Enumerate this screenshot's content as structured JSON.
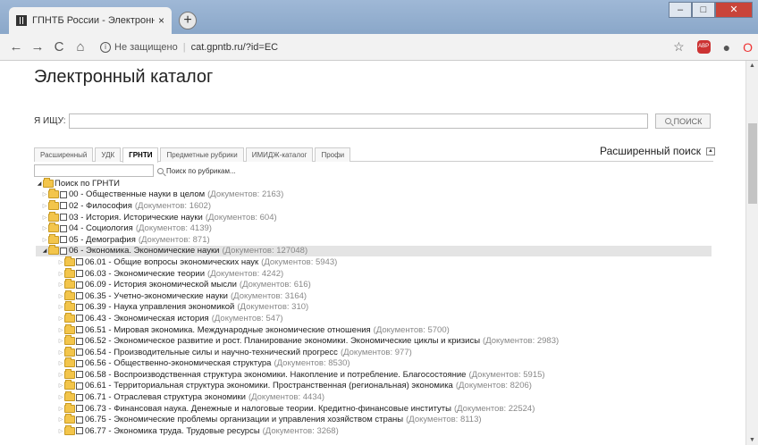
{
  "browser": {
    "tab_title": "ГПНТБ России - Электронный к",
    "tab_close": "×",
    "new_tab": "+",
    "security_label": "Не защищено",
    "url": "cat.gpntb.ru/?id=EC"
  },
  "page": {
    "title": "Электронный каталог",
    "search_label": "Я ИЩУ:",
    "search_value": "",
    "search_button": "ПОИСК",
    "advanced_search": "Расширенный поиск",
    "tabs": [
      "Расширенный",
      "УДК",
      "ГРНТИ",
      "Предметные рубрики",
      "ИМИДЖ-каталог",
      "Профи"
    ],
    "active_tab": "ГРНТИ",
    "rubric_button": "Поиск по рубрикам..."
  },
  "tree": {
    "root": "Поиск по ГРНТИ",
    "items": [
      {
        "label": "00 - Общественные науки в целом",
        "count": "(Документов: 2163)",
        "level": 1,
        "open": false
      },
      {
        "label": "02 - Философия",
        "count": "(Документов: 1602)",
        "level": 1,
        "open": false
      },
      {
        "label": "03 - История. Исторические науки",
        "count": "(Документов: 604)",
        "level": 1,
        "open": false
      },
      {
        "label": "04 - Социология",
        "count": "(Документов: 4139)",
        "level": 1,
        "open": false
      },
      {
        "label": "05 - Демография",
        "count": "(Документов: 871)",
        "level": 1,
        "open": false
      },
      {
        "label": "06 - Экономика. Экономические науки",
        "count": "(Документов: 127048)",
        "level": 1,
        "open": true,
        "selected": true
      },
      {
        "label": "06.01 - Общие вопросы экономических наук",
        "count": "(Документов: 5943)",
        "level": 2
      },
      {
        "label": "06.03 - Экономические теории",
        "count": "(Документов: 4242)",
        "level": 2
      },
      {
        "label": "06.09 - История экономической мысли",
        "count": "(Документов: 616)",
        "level": 2
      },
      {
        "label": "06.35 - Учетно-экономические науки",
        "count": "(Документов: 3164)",
        "level": 2
      },
      {
        "label": "06.39 - Наука управления экономикой",
        "count": "(Документов: 310)",
        "level": 2
      },
      {
        "label": "06.43 - Экономическая история",
        "count": "(Документов: 547)",
        "level": 2
      },
      {
        "label": "06.51 - Мировая экономика. Международные экономические отношения",
        "count": "(Документов: 5700)",
        "level": 2
      },
      {
        "label": "06.52 - Экономическое развитие и рост. Планирование экономики. Экономические циклы и кризисы",
        "count": "(Документов: 2983)",
        "level": 2
      },
      {
        "label": "06.54 - Производительные силы и научно-технический прогресс",
        "count": "(Документов: 977)",
        "level": 2
      },
      {
        "label": "06.56 - Общественно-экономическая структура",
        "count": "(Документов: 8530)",
        "level": 2
      },
      {
        "label": "06.58 - Воспроизводственная структура экономики. Накопление и потребление. Благосостояние",
        "count": "(Документов: 5915)",
        "level": 2
      },
      {
        "label": "06.61 - Территориальная структура экономики. Пространственная (региональная) экономика",
        "count": "(Документов: 8206)",
        "level": 2
      },
      {
        "label": "06.71 - Отраслевая структура экономики",
        "count": "(Документов: 4434)",
        "level": 2
      },
      {
        "label": "06.73 - Финансовая наука. Денежные и налоговые теории. Кредитно-финансовые институты",
        "count": "(Документов: 22524)",
        "level": 2
      },
      {
        "label": "06.75 - Экономические проблемы организации и управления хозяйством страны",
        "count": "(Документов: 8113)",
        "level": 2
      },
      {
        "label": "06.77 - Экономика труда. Трудовые ресурсы",
        "count": "(Документов: 3268)",
        "level": 2
      }
    ]
  }
}
